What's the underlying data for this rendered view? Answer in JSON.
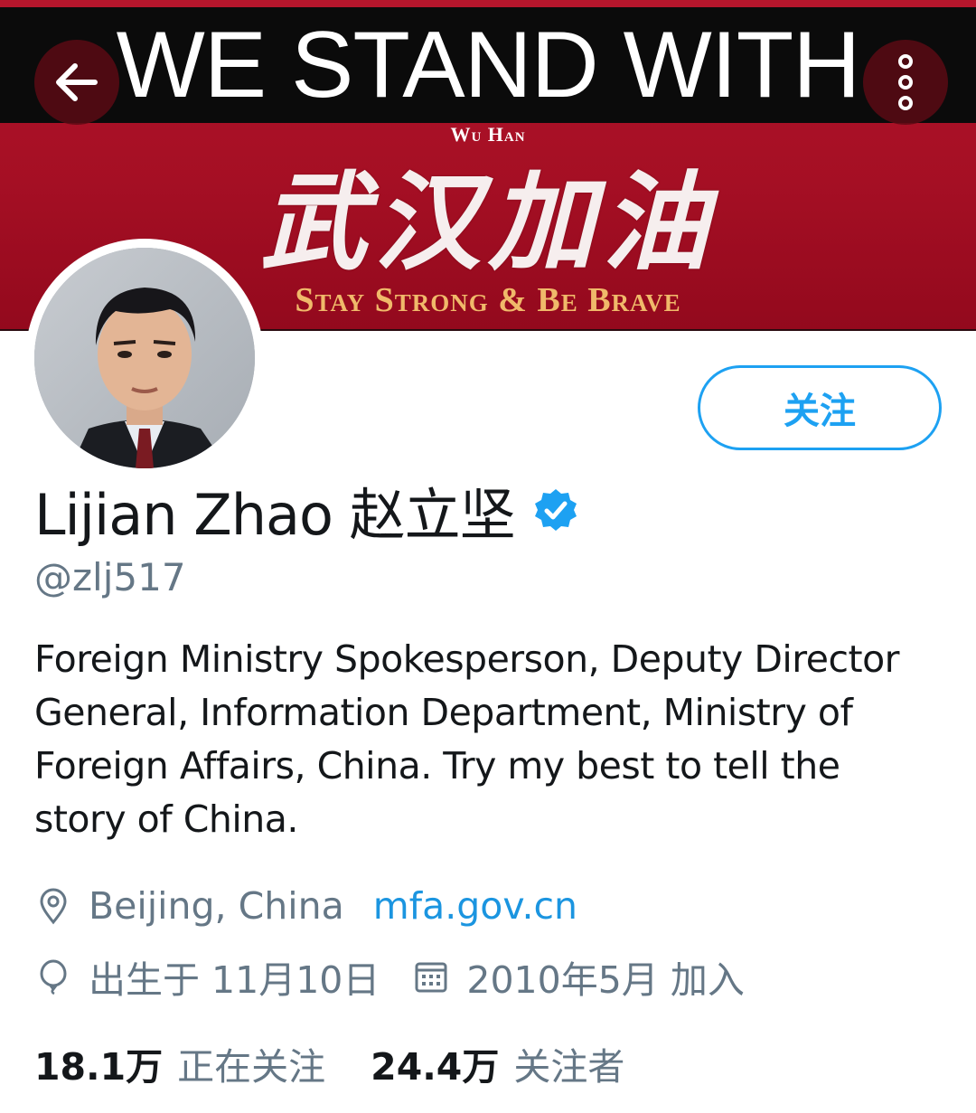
{
  "banner": {
    "headline": "WE STAND WITH",
    "subtitle": "Wu Han",
    "calligraphy": "武汉加油",
    "tagline": "Stay Strong & Be Brave"
  },
  "header": {
    "back_icon": "arrow-left-icon",
    "more_icon": "more-vertical-icon"
  },
  "profile": {
    "follow_label": "关注",
    "display_name": "Lijian Zhao 赵立坚",
    "verified_icon": "verified-badge-icon",
    "handle": "@zlj517",
    "bio_lines": [
      "Foreign Ministry Spokesperson, Deputy Director",
      "General, Information Department, Ministry of",
      "Foreign Affairs, China. Try my best to tell the",
      "story of China."
    ],
    "location": "Beijing, China",
    "website": "mfa.gov.cn",
    "birthday": "出生于 11月10日",
    "joined": "2010年5月 加入",
    "following_count": "18.1万",
    "following_label": "正在关注",
    "followers_count": "24.4万",
    "followers_label": "关注者"
  },
  "colors": {
    "accent": "#1da1f2",
    "link": "#1b95e0",
    "muted": "#657786",
    "banner_red": "#a50f24",
    "tagline_gold": "#f0b96a"
  }
}
